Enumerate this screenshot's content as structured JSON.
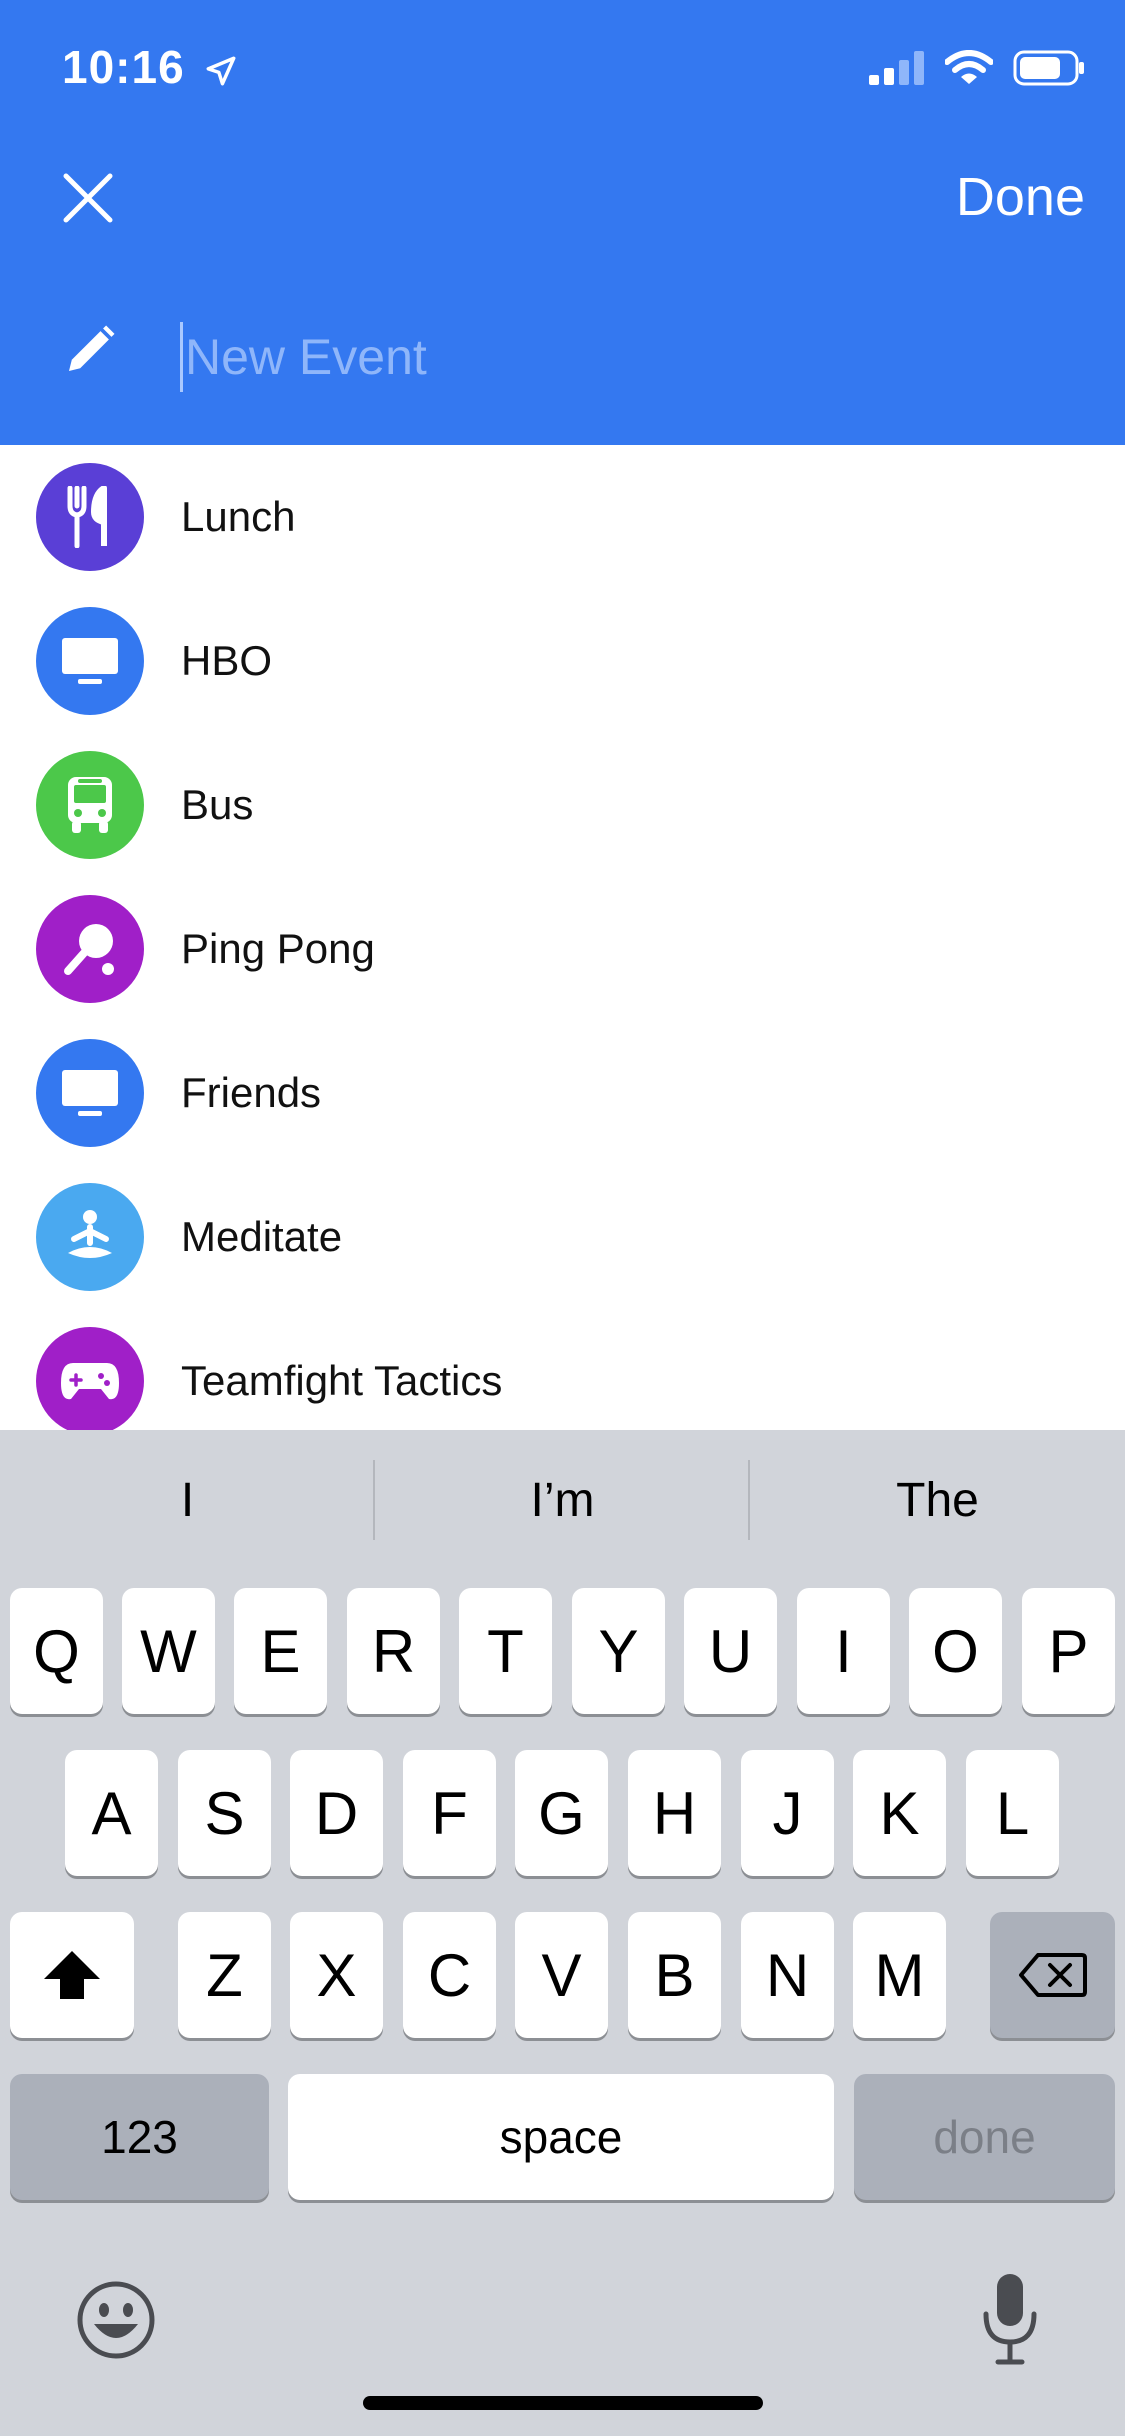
{
  "status": {
    "time": "10:16"
  },
  "header": {
    "done_label": "Done",
    "title_placeholder": "New Event",
    "title_value": ""
  },
  "events": [
    {
      "label": "Lunch",
      "icon": "fork-knife-icon",
      "color": "#5a3fd6"
    },
    {
      "label": "HBO",
      "icon": "tv-icon",
      "color": "#3478f0"
    },
    {
      "label": "Bus",
      "icon": "bus-icon",
      "color": "#4cc84a"
    },
    {
      "label": "Ping Pong",
      "icon": "ping-pong-icon",
      "color": "#a01fc8"
    },
    {
      "label": "Friends",
      "icon": "tv-icon",
      "color": "#3478f0"
    },
    {
      "label": "Meditate",
      "icon": "meditate-icon",
      "color": "#4aa9f0"
    },
    {
      "label": "Teamfight Tactics",
      "icon": "gamepad-icon",
      "color": "#a01fc8"
    }
  ],
  "keyboard": {
    "suggestions": [
      "I",
      "I’m",
      "The"
    ],
    "row1": [
      "Q",
      "W",
      "E",
      "R",
      "T",
      "Y",
      "U",
      "I",
      "O",
      "P"
    ],
    "row2": [
      "A",
      "S",
      "D",
      "F",
      "G",
      "H",
      "J",
      "K",
      "L"
    ],
    "row3": [
      "Z",
      "X",
      "C",
      "V",
      "B",
      "N",
      "M"
    ],
    "numbers_label": "123",
    "space_label": "space",
    "done_label": "done"
  }
}
